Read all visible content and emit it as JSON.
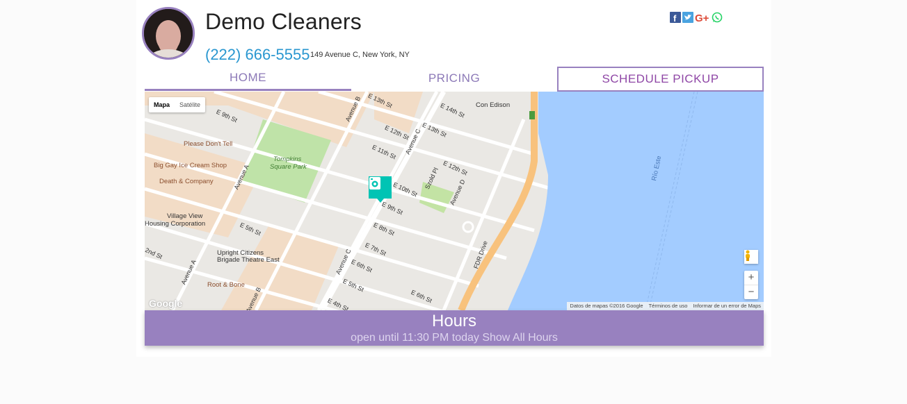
{
  "business": {
    "name": "Demo Cleaners",
    "phone": "(222) 666-5555",
    "address": "149 Avenue C, New York, NY"
  },
  "social": [
    "facebook-icon",
    "twitter-icon",
    "google-plus-icon",
    "whatsapp-icon"
  ],
  "tabs": {
    "home": "HOME",
    "pricing": "PRICING",
    "schedule": "SCHEDULE PICKUP"
  },
  "map": {
    "toggle": {
      "map": "Mapa",
      "satellite": "Satélite"
    },
    "labels": {
      "con_edison": "Con Edison",
      "please_dont_tell": "Please Don't Tell",
      "big_gay": "Big Gay Ice Cream Shop",
      "death_company": "Death & Company",
      "tompkins": "Tompkins",
      "square_park": "Square Park",
      "village_view": "Village View",
      "housing_corp": "Housing Corporation",
      "ucb_1": "Upright Citizens",
      "ucb_2": "Brigade Theatre East",
      "root_bone": "Root & Bone",
      "rio_este": "Río Este",
      "fdr": "FDR Drive",
      "e9": "E 9th St",
      "e5": "E 5th St",
      "e2": "2nd St",
      "e13": "E 13th St",
      "e14": "E 14th St",
      "e12": "E 12th St",
      "e13b": "E 13th St",
      "e11": "E 11th St",
      "e12b": "E 12th St",
      "e10": "E 10th St",
      "e9b": "E 9th St",
      "e8": "E 8th St",
      "e7": "E 7th St",
      "e6": "E 6th St",
      "e5b": "E 5th St",
      "e4": "E 4th St",
      "e6b": "E 6th St",
      "avea": "Avenue A",
      "avea2": "Avenue A",
      "aveb": "Avenue B",
      "aveb2": "Avenue B",
      "avec": "Avenue C",
      "avec2": "Avenue C",
      "aved": "Avenue D",
      "szold": "Szold Pl"
    },
    "attribution": [
      "Datos de mapas ©2016 Google",
      "Términos de uso",
      "Informar de un error de Maps"
    ],
    "logo": "Google",
    "zoom_in": "+",
    "zoom_out": "−"
  },
  "hours": {
    "title": "Hours",
    "subtitle": "open until 11:30 PM today Show All Hours"
  },
  "colors": {
    "accent": "#9881bf",
    "link": "#2a97d0",
    "marker": "#00c4b4",
    "water": "#a3ccff"
  }
}
